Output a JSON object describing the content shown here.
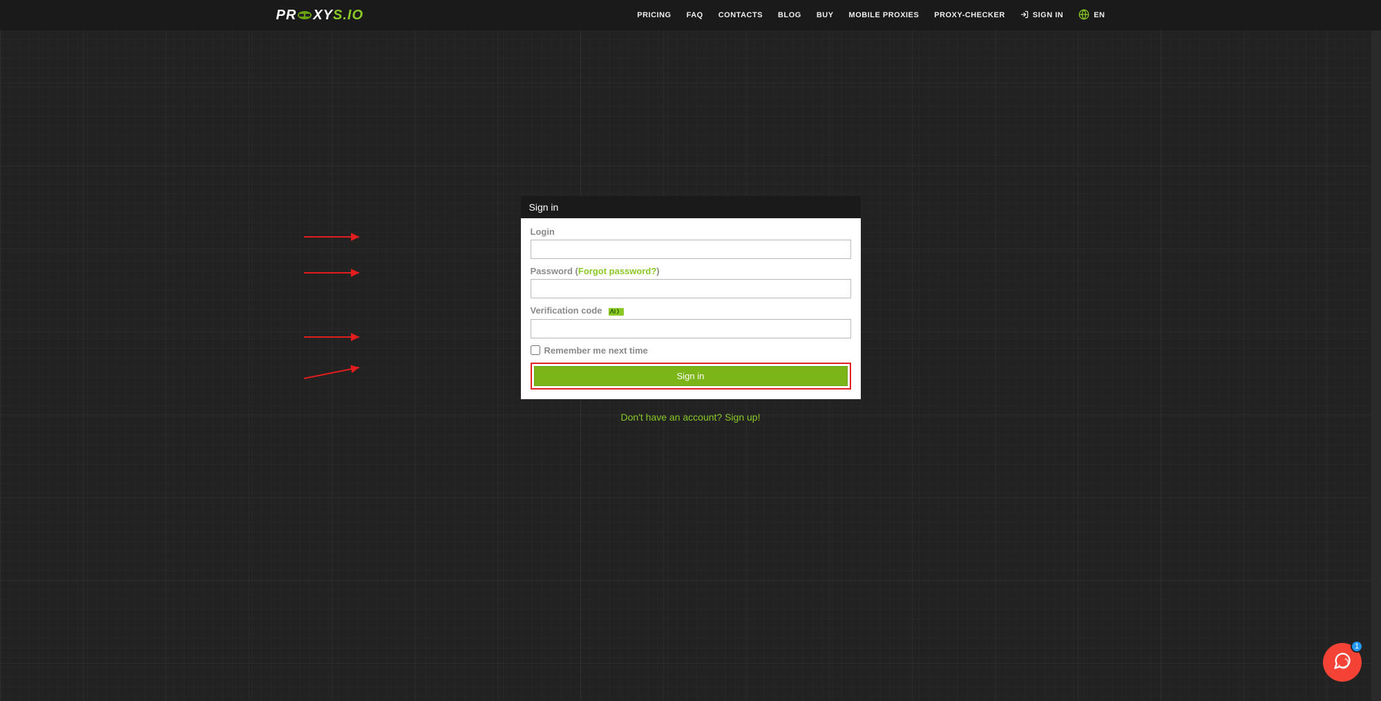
{
  "brand": {
    "part1": "PR",
    "part2": "XY",
    "part3": "S.IO"
  },
  "nav": {
    "pricing": "PRICING",
    "faq": "FAQ",
    "contacts": "CONTACTS",
    "blog": "BLOG",
    "buy": "BUY",
    "mobile": "MOBILE PROXIES",
    "checker": "PROXY-CHECKER",
    "signin": "SIGN IN",
    "lang": "EN"
  },
  "card": {
    "title": "Sign in",
    "login_label": "Login",
    "password_label": "Password",
    "forgot_prefix": "(",
    "forgot_text": "Forgot password?",
    "forgot_suffix": ")",
    "verification_label": "Verification code",
    "remember_label": "Remember me next time",
    "submit": "Sign in"
  },
  "below": {
    "signup": "Don't have an account? Sign up!"
  },
  "chat": {
    "badge": "1"
  }
}
